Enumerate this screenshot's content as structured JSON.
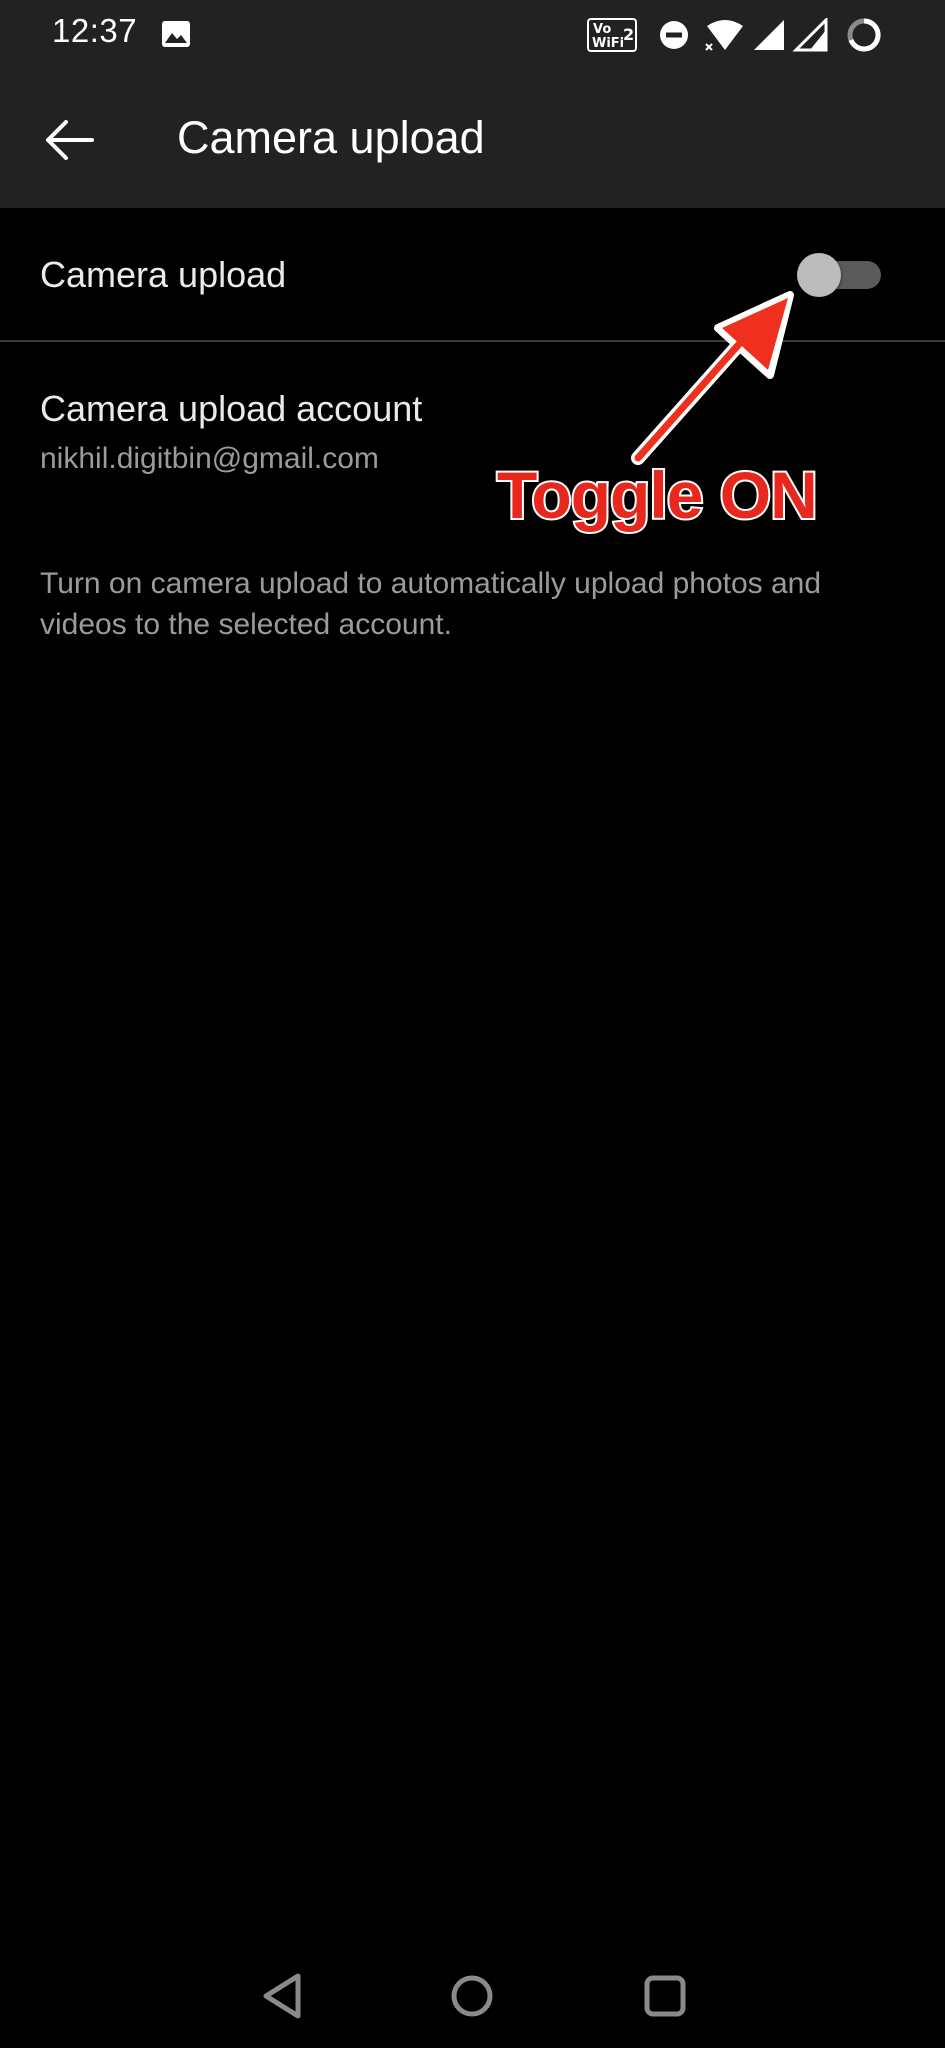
{
  "status_bar": {
    "time": "12:37",
    "network_badge": "Vo WiFi 2",
    "icons": [
      "gallery-icon",
      "vowifi-icon",
      "dnd-icon",
      "wifi-icon",
      "signal-icon",
      "signal-2-icon",
      "battery-ring-icon"
    ]
  },
  "app_bar": {
    "back_icon": "arrow-left-icon",
    "title": "Camera upload"
  },
  "settings": {
    "camera_upload": {
      "label": "Camera upload",
      "enabled": false
    },
    "account": {
      "title": "Camera upload account",
      "email": "nikhil.digitbin@gmail.com"
    },
    "description": "Turn on camera upload to automatically upload photos and videos to the selected account."
  },
  "annotation": {
    "text": "Toggle ON",
    "color": "#e8281e"
  },
  "nav_bar": {
    "buttons": [
      "back-triangle-icon",
      "home-circle-icon",
      "recents-square-icon"
    ]
  },
  "colors": {
    "background": "#000000",
    "bar": "#222222",
    "primary_text": "#ebebeb",
    "secondary_text": "#9b9b9b",
    "switch_thumb": "#bcbcbc",
    "switch_track": "#5a5a5a"
  }
}
